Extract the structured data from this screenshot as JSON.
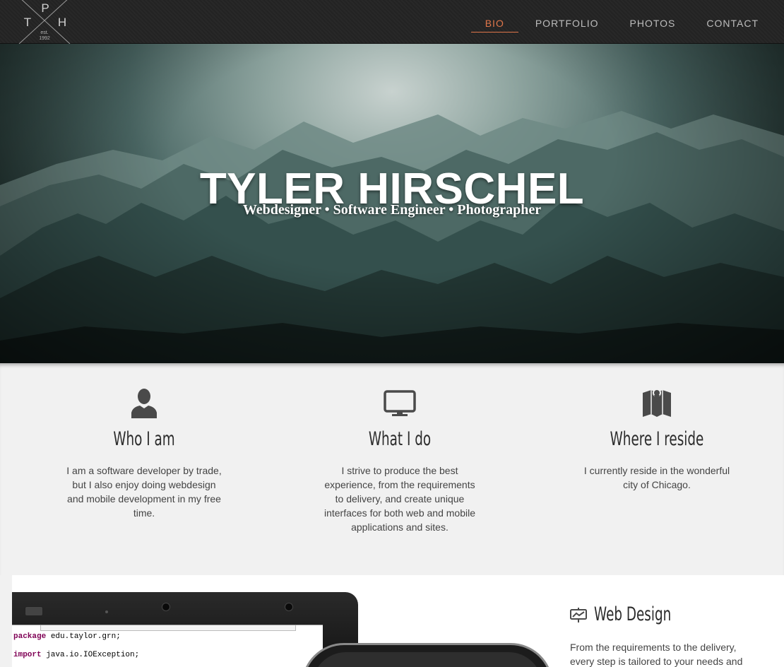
{
  "logo": {
    "letters": [
      "T",
      "P",
      "H"
    ],
    "est": "est.",
    "year": "1992"
  },
  "nav": {
    "items": [
      {
        "label": "BIO",
        "active": true
      },
      {
        "label": "PORTFOLIO",
        "active": false
      },
      {
        "label": "PHOTOS",
        "active": false
      },
      {
        "label": "CONTACT",
        "active": false
      }
    ],
    "active_color": "#e0764a"
  },
  "hero": {
    "title": "TYLER HIRSCHEL",
    "subtitle": "Webdesigner • Software Engineer • Photographer"
  },
  "features": [
    {
      "icon": "user-icon",
      "title": "Who I am",
      "text": "I am a software developer by trade, but I also enjoy doing webdesign and mobile development in my free time."
    },
    {
      "icon": "monitor-icon",
      "title": "What I do",
      "text": "I strive to produce the best experience, from the requirements to delivery, and create unique interfaces for both web and mobile applications and sites."
    },
    {
      "icon": "map-pin-icon",
      "title": "Where I reside",
      "text": "I currently reside in the wonderful city of Chicago."
    }
  ],
  "showcase": {
    "code_lines": [
      {
        "keyword": "package",
        "rest": " edu.taylor.grn;"
      },
      {
        "keyword": "import",
        "rest": " java.io.IOException;"
      }
    ],
    "service": {
      "icon": "presentation-icon",
      "title": "Web Design",
      "text": "From the requirements to the delivery, every step is tailored to your needs and"
    }
  }
}
